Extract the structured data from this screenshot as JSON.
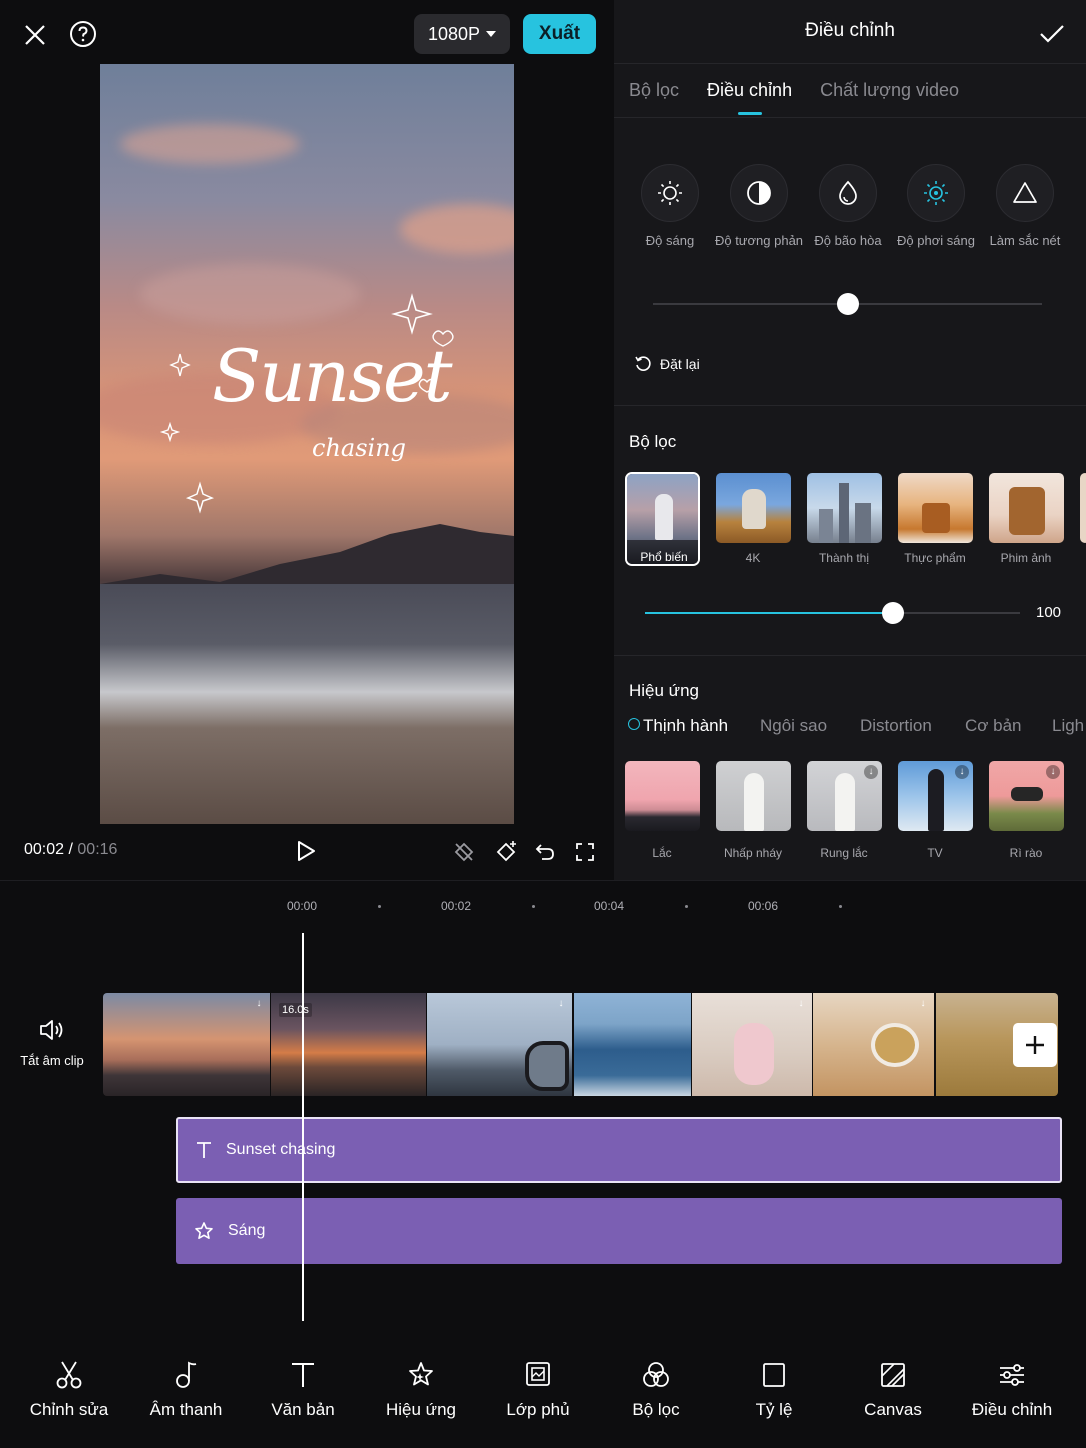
{
  "preview": {
    "close_icon": "close-icon",
    "help_icon": "help-icon",
    "resolution": "1080P",
    "export_label": "Xuất",
    "overlay_title": "Sunset",
    "overlay_subtitle": "chasing",
    "time_current": "00:02",
    "time_separator": " / ",
    "time_total": "00:16"
  },
  "panel": {
    "title": "Điều chỉnh",
    "tabs": [
      {
        "label": "Bộ lọc",
        "active": false
      },
      {
        "label": "Điều chỉnh",
        "active": true
      },
      {
        "label": "Chất lượng video",
        "active": false
      }
    ],
    "adjustments": [
      {
        "label": "Độ sáng",
        "icon": "brightness-icon"
      },
      {
        "label": "Độ tương phản",
        "icon": "contrast-icon"
      },
      {
        "label": "Độ bão hòa",
        "icon": "saturation-icon"
      },
      {
        "label": "Độ phơi sáng",
        "icon": "exposure-icon"
      },
      {
        "label": "Làm sắc nét",
        "icon": "sharpen-icon"
      }
    ],
    "adjust_slider_value": 0.5,
    "reset_label": "Đặt lại",
    "filters_title": "Bộ lọc",
    "filters": [
      {
        "label": "Phổ biến",
        "selected": true
      },
      {
        "label": "4K"
      },
      {
        "label": "Thành thị"
      },
      {
        "label": "Thực phẩm"
      },
      {
        "label": "Phim ảnh"
      }
    ],
    "filter_strength": "100",
    "filter_strength_fraction": 0.66,
    "effects_title": "Hiệu ứng",
    "effect_categories": [
      "Thịnh hành",
      "Ngôi sao",
      "Distortion",
      "Cơ bản",
      "Ligh"
    ],
    "effects": [
      {
        "label": "Lắc"
      },
      {
        "label": "Nhấp nháy"
      },
      {
        "label": "Rung lắc"
      },
      {
        "label": "TV"
      },
      {
        "label": "Rì rào"
      }
    ]
  },
  "timeline": {
    "ruler": [
      "00:00",
      "00:02",
      "00:04",
      "00:06"
    ],
    "mute_label": "Tắt âm clip",
    "clip_duration": "16.0s",
    "text_track": "Sunset chasing",
    "effect_track": "Sáng"
  },
  "toolbar": [
    {
      "label": "Chỉnh sửa",
      "icon": "scissors-icon"
    },
    {
      "label": "Âm thanh",
      "icon": "music-note-icon"
    },
    {
      "label": "Văn bản",
      "icon": "text-icon"
    },
    {
      "label": "Hiệu ứng",
      "icon": "effects-star-icon"
    },
    {
      "label": "Lớp phủ",
      "icon": "overlay-icon"
    },
    {
      "label": "Bộ lọc",
      "icon": "filter-icon"
    },
    {
      "label": "Tỷ lệ",
      "icon": "ratio-icon"
    },
    {
      "label": "Canvas",
      "icon": "canvas-icon"
    },
    {
      "label": "Điều chỉnh",
      "icon": "adjust-icon"
    }
  ],
  "colors": {
    "accent": "#27c3df",
    "track": "#7b5fb3",
    "background": "#0d0d0f"
  }
}
